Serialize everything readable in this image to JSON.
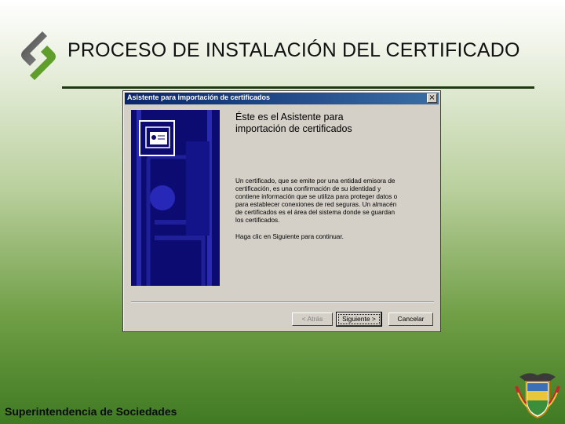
{
  "slide": {
    "title": "PROCESO DE INSTALACIÓN DEL CERTIFICADO",
    "footer": "Superintendencia de Sociedades"
  },
  "dialog": {
    "title": "Asistente para importación de certificados",
    "close_label": "×",
    "heading_line1": "Éste es el Asistente para",
    "heading_line2": "importación de certificados",
    "body_lines": [
      "Un certificado, que se emite por una entidad emisora de",
      "certificación, es una confirmación de su identidad y",
      "contiene información que se utiliza para proteger datos o",
      "para establecer conexiones de red seguras. Un almacén",
      "de certificados es el área del sistema donde se guardan",
      "los certificados."
    ],
    "hint": "Haga clic en Siguiente para continuar.",
    "buttons": {
      "back": "< Atrás",
      "next": "Siguiente >",
      "cancel": "Cancelar"
    }
  },
  "colors": {
    "titlebar": "#0a246a",
    "side_panel": "#0b0b72",
    "dialog_face": "#d4d0c8",
    "rule": "#1e3a10"
  }
}
